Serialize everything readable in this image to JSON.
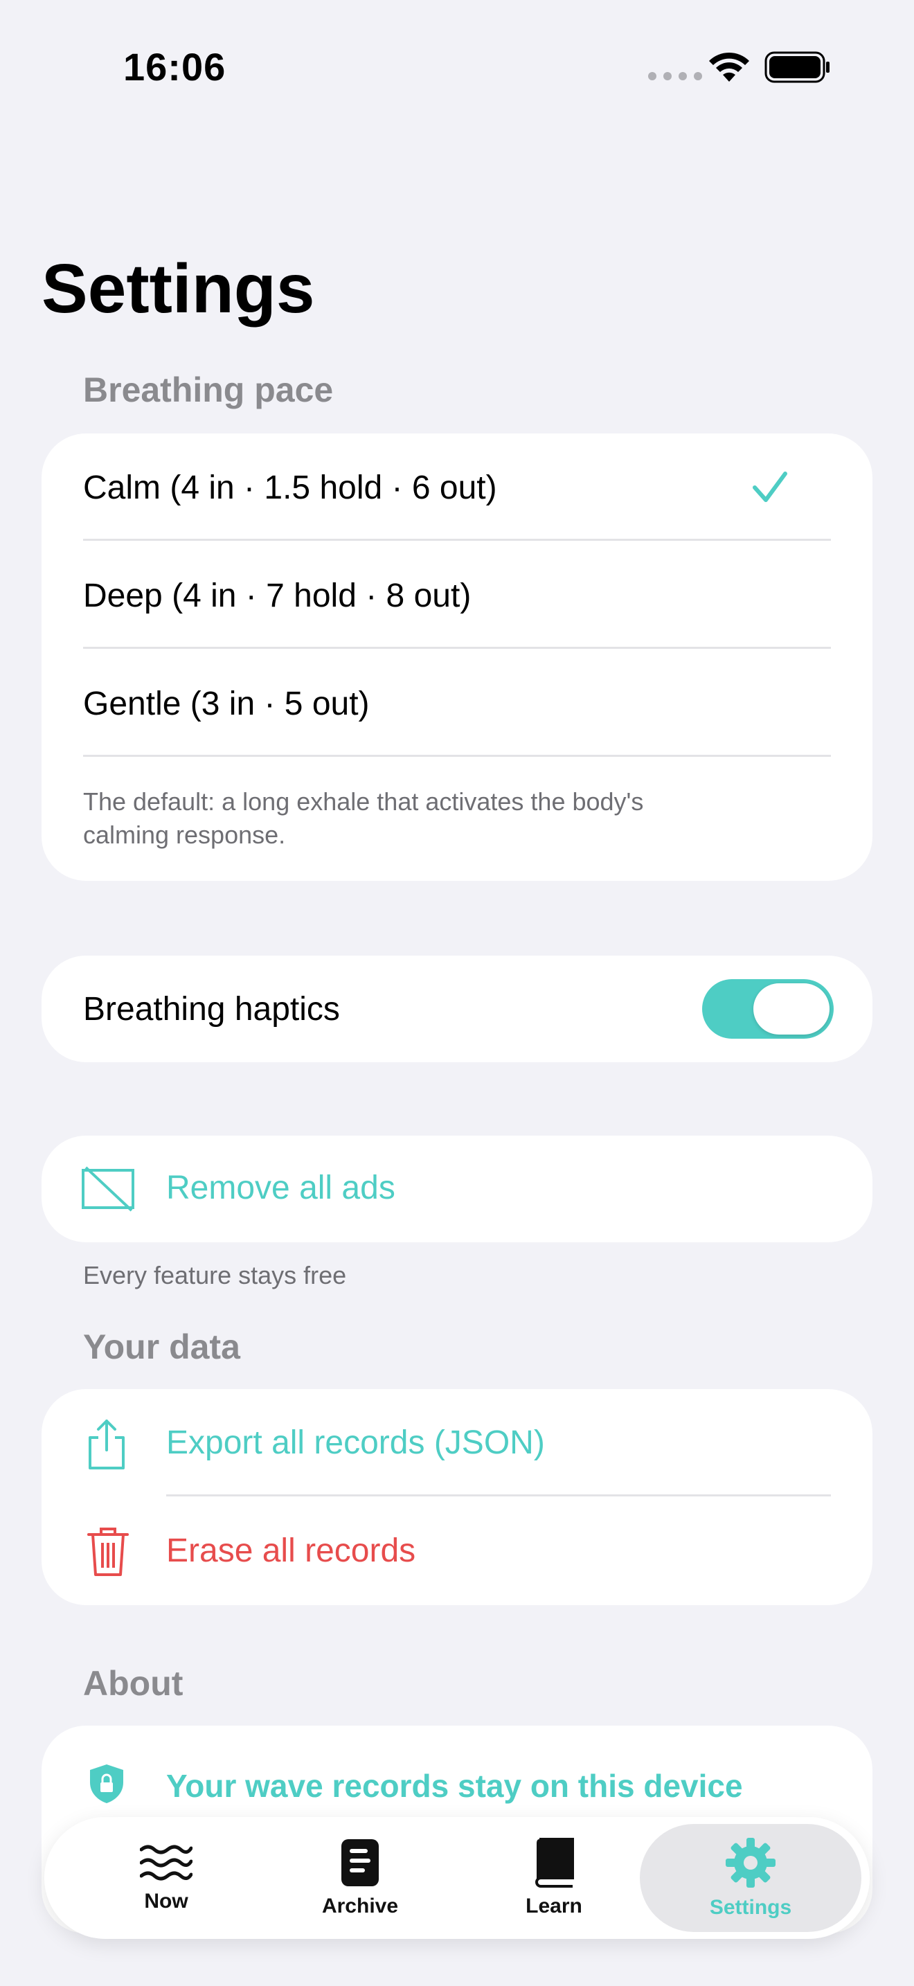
{
  "status_bar": {
    "time": "16:06"
  },
  "page_title": "Settings",
  "breathing_pace": {
    "header": "Breathing pace",
    "options": [
      {
        "label": "Calm (4 in · 1.5 hold · 6 out)",
        "selected": true
      },
      {
        "label": "Deep (4 in · 7 hold · 8 out)",
        "selected": false
      },
      {
        "label": "Gentle (3 in · 5 out)",
        "selected": false
      }
    ],
    "description_line1": "The default: a long exhale that activates the body's",
    "description_line2": "calming response."
  },
  "haptics": {
    "label": "Breathing haptics",
    "enabled": true
  },
  "ads": {
    "label": "Remove all ads",
    "footnote": "Every feature stays free"
  },
  "your_data": {
    "header": "Your data",
    "export_label": "Export all records (JSON)",
    "erase_label": "Erase all records"
  },
  "about": {
    "header": "About",
    "privacy_label": "Your wave records stay on this device"
  },
  "tabbar": {
    "tabs": [
      {
        "label": "Now",
        "icon": "waves-icon"
      },
      {
        "label": "Archive",
        "icon": "archive-icon"
      },
      {
        "label": "Learn",
        "icon": "book-icon"
      },
      {
        "label": "Settings",
        "icon": "gear-icon",
        "active": true
      }
    ]
  },
  "colors": {
    "accent": "#4ecdc4",
    "destructive": "#e74c4c",
    "background": "#f2f2f7"
  }
}
